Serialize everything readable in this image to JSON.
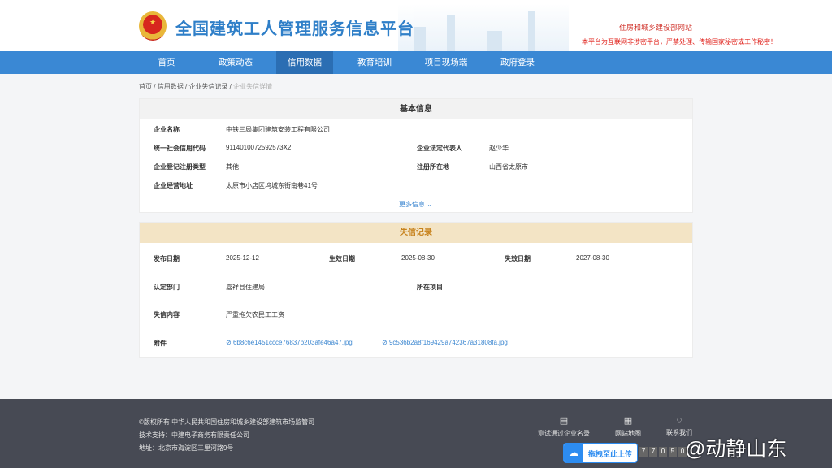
{
  "header": {
    "site_title": "全国建筑工人管理服务信息平台",
    "ministry_link": "住房和城乡建设部网站",
    "warning": "本平台为互联网非涉密平台，严禁处理、传输国家秘密或工作秘密！"
  },
  "nav": [
    {
      "label": "首页"
    },
    {
      "label": "政策动态"
    },
    {
      "label": "信用数据",
      "active": true
    },
    {
      "label": "教育培训"
    },
    {
      "label": "项目现场端"
    },
    {
      "label": "政府登录"
    }
  ],
  "breadcrumb": {
    "items": [
      "首页",
      "信用数据",
      "企业失信记录"
    ],
    "current": "企业失信详情",
    "sep": "/"
  },
  "basic": {
    "title": "基本信息",
    "name_label": "企业名称",
    "name": "中铁三局集团建筑安装工程有限公司",
    "code_label": "统一社会信用代码",
    "code": "9114010072592573X2",
    "legal_label": "企业法定代表人",
    "legal": "赵少华",
    "type_label": "企业登记注册类型",
    "type": "其他",
    "region_label": "注册所在地",
    "region": "山西省太原市",
    "addr_label": "企业经营地址",
    "addr": "太原市小店区坞城东街南巷41号",
    "more": "更多信息"
  },
  "record": {
    "title": "失信记录",
    "publish_label": "发布日期",
    "publish": "2025-12-12",
    "effective_label": "生效日期",
    "effective": "2025-08-30",
    "expire_label": "失效日期",
    "expire": "2027-08-30",
    "dept_label": "认定部门",
    "dept": "嘉祥县住建局",
    "project_label": "所在项目",
    "content_label": "失信内容",
    "content": "严重拖欠农民工工资",
    "attach_label": "附件",
    "attachments": [
      "6b8c6e1451ccce76837b203afe46a47.jpg",
      "9c536b2a8f169429a742367a31808fa.jpg"
    ]
  },
  "footer": {
    "copyright": "©版权所有 中华人民共和国住房和城乡建设部建筑市场监管司",
    "support": "技术支持：中建电子商务有限责任公司",
    "address": "地址：北京市海淀区三里河路9号",
    "links": [
      "测试通过企业名录",
      "网站地图",
      "联系我们"
    ],
    "upload": "拖拽至此上传",
    "counter": [
      "7",
      "7",
      "0",
      "5",
      "0"
    ],
    "watermark": "@动静山东"
  }
}
